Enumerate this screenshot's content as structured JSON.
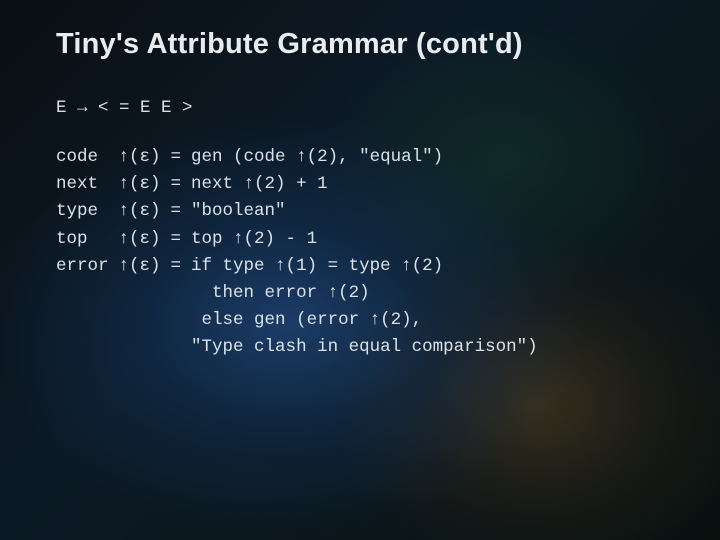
{
  "title": "Tiny's Attribute Grammar (cont'd)",
  "production": "E → < = E E >",
  "rows": [
    {
      "attr": "code",
      "inh": "↑(ε)",
      "eq": "=",
      "rhs": "gen (code ↑(2), \"equal\")"
    },
    {
      "attr": "next",
      "inh": "↑(ε)",
      "eq": "=",
      "rhs": "next ↑(2) + 1"
    },
    {
      "attr": "type",
      "inh": "↑(ε)",
      "eq": "=",
      "rhs": "\"boolean\""
    },
    {
      "attr": "top",
      "inh": "↑(ε)",
      "eq": "=",
      "rhs": "top ↑(2) - 1"
    },
    {
      "attr": "error",
      "inh": "↑(ε)",
      "eq": "=",
      "rhs": "if type ↑(1) = type ↑(2)\n  then error ↑(2)\n else gen (error ↑(2),\n\"Type clash in equal comparison\")"
    }
  ]
}
